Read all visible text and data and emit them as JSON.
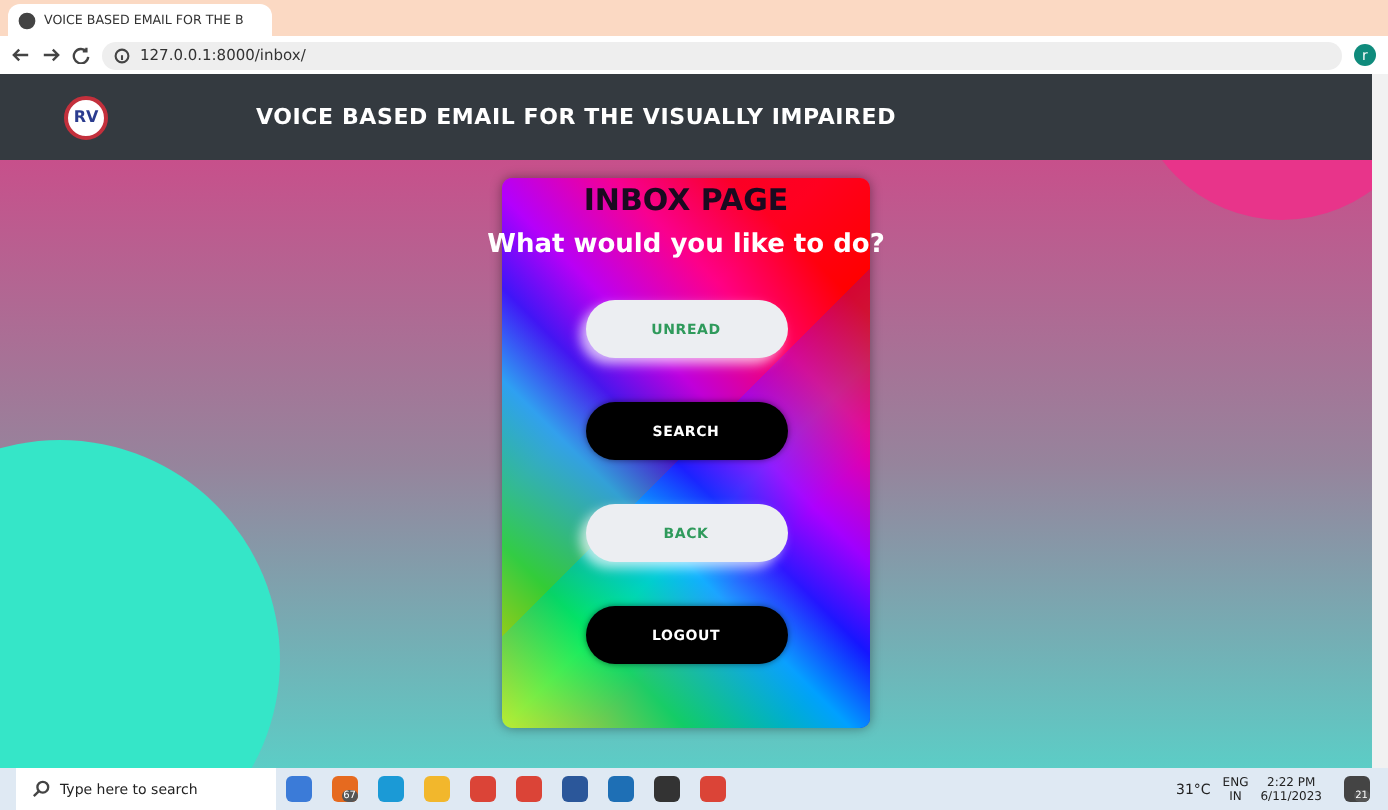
{
  "browser": {
    "tab_title": "VOICE BASED EMAIL FOR THE B",
    "url": "127.0.0.1:8000/inbox/",
    "profile_initial": "r"
  },
  "header": {
    "logo_text": "RV",
    "title": "VOICE BASED EMAIL FOR THE VISUALLY IMPAIRED"
  },
  "card": {
    "heading": "INBOX PAGE",
    "prompt": "What would you like to do?",
    "buttons": [
      {
        "label": "UNREAD",
        "kind": "light"
      },
      {
        "label": "SEARCH",
        "kind": "dark"
      },
      {
        "label": "BACK",
        "kind": "light"
      },
      {
        "label": "LOGOUT",
        "kind": "dark"
      }
    ]
  },
  "taskbar": {
    "search_placeholder": "Type here to search",
    "mail_badge": "67",
    "temperature": "31°C",
    "language": "ENG",
    "region": "IN",
    "time": "2:22 PM",
    "date": "6/11/2023",
    "notifications": "21"
  }
}
